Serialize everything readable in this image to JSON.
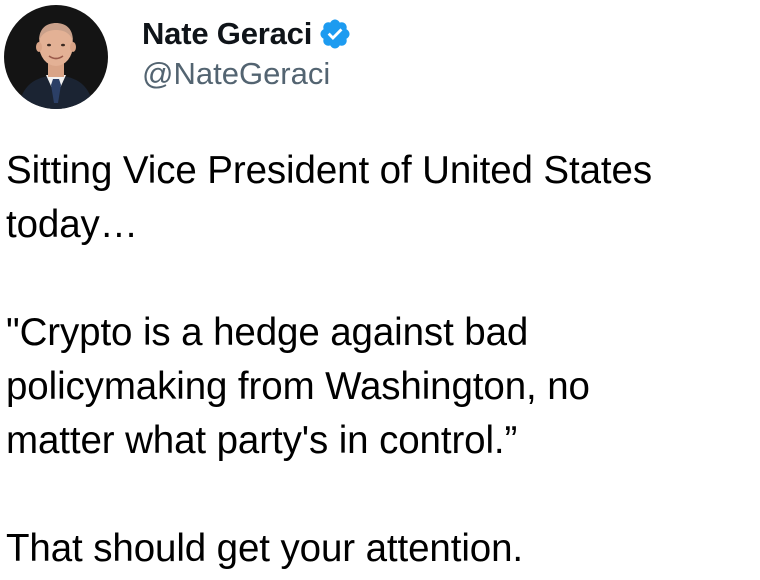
{
  "author": {
    "display_name": "Nate Geraci",
    "handle": "@NateGeraci",
    "verified": true,
    "verified_icon": "verified-badge-icon",
    "avatar_icon": "profile-photo"
  },
  "tweet": {
    "line1": "Sitting Vice President of United States\ntoday…",
    "quote": "\"Crypto is a hedge against bad\npolicymaking from Washington, no\nmatter what party's in control.”",
    "closing": "That should get your attention."
  },
  "colors": {
    "text": "#000000",
    "handle": "#536471",
    "verified": "#1d9bf0",
    "background": "#ffffff"
  }
}
